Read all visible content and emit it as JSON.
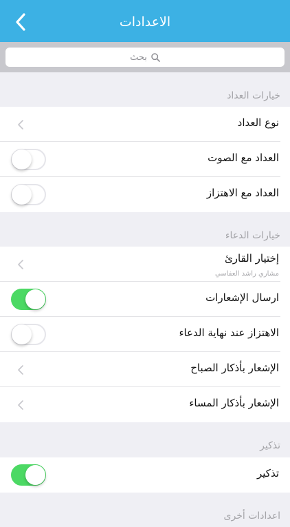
{
  "navbar": {
    "title": "الاعدادات",
    "back_icon": "chevron-left-icon"
  },
  "search": {
    "placeholder": "بحث",
    "icon": "search-icon"
  },
  "sections": [
    {
      "header": "خيارات العداد",
      "rows": [
        {
          "label": "نوع العداد",
          "control": "chevron"
        },
        {
          "label": "العداد مع الصوت",
          "control": "toggle",
          "on": false
        },
        {
          "label": "العداد مع الاهتزاز",
          "control": "toggle",
          "on": false
        }
      ]
    },
    {
      "header": "خيارات الدعاء",
      "rows": [
        {
          "label": "إختيار القارئ",
          "sublabel": "مشاري راشد العفاسي",
          "control": "chevron"
        },
        {
          "label": "ارسال الإشعارات",
          "control": "toggle",
          "on": true
        },
        {
          "label": "الاهتزاز عند نهاية الدعاء",
          "control": "toggle",
          "on": false
        },
        {
          "label": "الإشعار بأذكار الصباح",
          "control": "chevron"
        },
        {
          "label": "الإشعار بأذكار المساء",
          "control": "chevron"
        }
      ]
    },
    {
      "header": "تذكير",
      "rows": [
        {
          "label": "تذكير",
          "control": "toggle",
          "on": true
        }
      ]
    },
    {
      "header": "اعدادات أخرى",
      "rows": []
    }
  ],
  "colors": {
    "accent": "#3cb1e4",
    "toggle_on": "#4cd964",
    "background": "#efeff4"
  }
}
